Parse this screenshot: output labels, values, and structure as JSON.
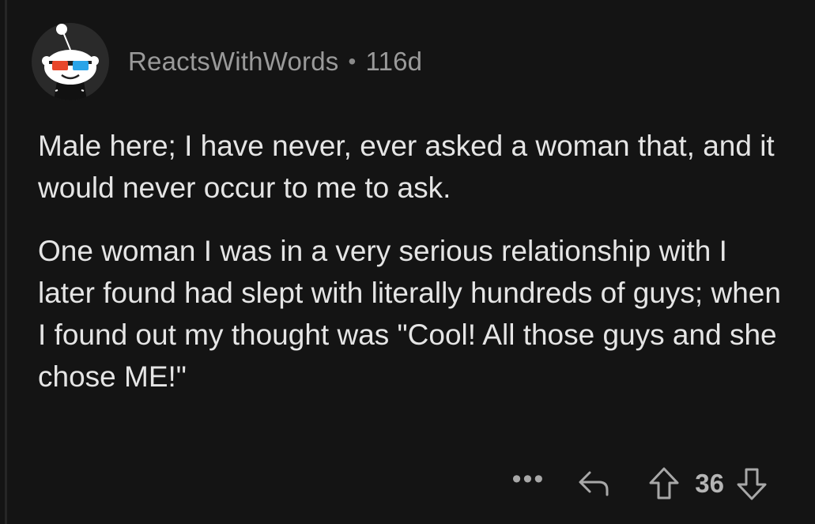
{
  "comment": {
    "author": "ReactsWithWords",
    "separator": "•",
    "age": "116d",
    "paragraphs": [
      "Male here; I have never, ever asked a woman that, and it would never occur to me to ask.",
      "One woman I was in a very serious relationship with I later found had slept with literally hundreds of guys; when I found out my thought was \"Cool!  All those guys and she chose ME!\""
    ]
  },
  "actions": {
    "more_label": "•••",
    "score": "36",
    "icons": {
      "more": "more-icon",
      "reply": "reply-icon",
      "upvote": "upvote-icon",
      "downvote": "downvote-icon"
    }
  },
  "colors": {
    "background": "#141414",
    "text": "#e5e5e5",
    "meta": "#9a9a9a",
    "avatar_bg": "#2a2a2a"
  }
}
